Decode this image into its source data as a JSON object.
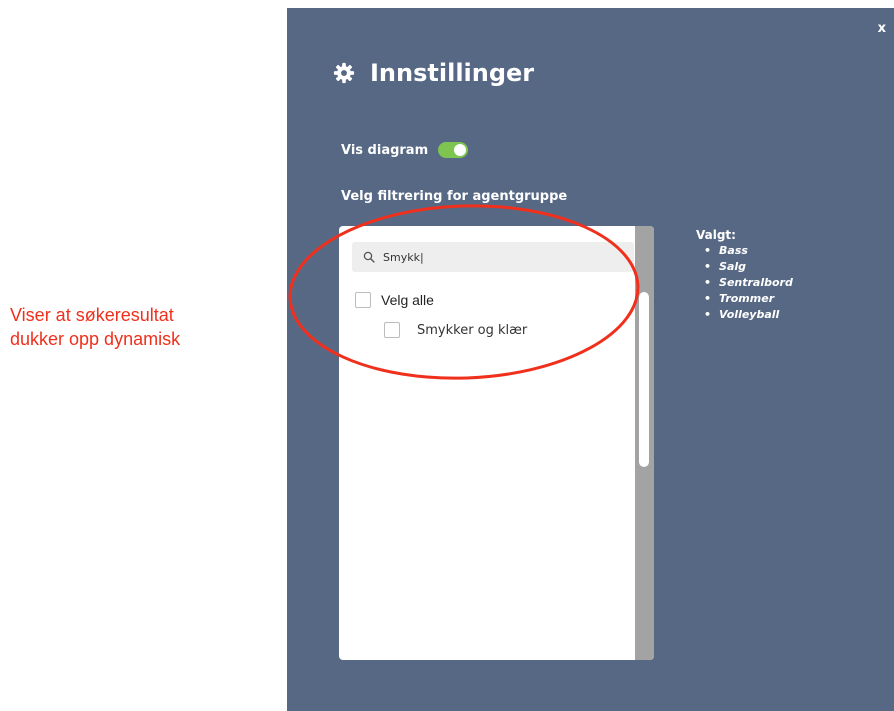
{
  "annotation": {
    "line1": "Viser at søkeresultat",
    "line2": "dukker opp dynamisk"
  },
  "dialog": {
    "close_label": "x",
    "title": "Innstillinger",
    "title_icon": "gear-icon",
    "toggle": {
      "label": "Vis diagram",
      "on": true,
      "color": "#7ec451"
    },
    "filter_label": "Velg filtrering for agentgruppe",
    "search": {
      "value": "Smykk|",
      "icon": "search-icon"
    },
    "select_all_label": "Velg alle",
    "results": [
      {
        "label": "Smykker og klær",
        "checked": false
      }
    ],
    "selected": {
      "title": "Valgt:",
      "items": [
        "Bass",
        "Salg",
        "Sentralbord",
        "Trommer",
        "Volleyball"
      ]
    }
  },
  "colors": {
    "panel_bg": "#566884",
    "annotation_red": "#f0301c",
    "scrollbar_track": "#a3a3a3"
  }
}
